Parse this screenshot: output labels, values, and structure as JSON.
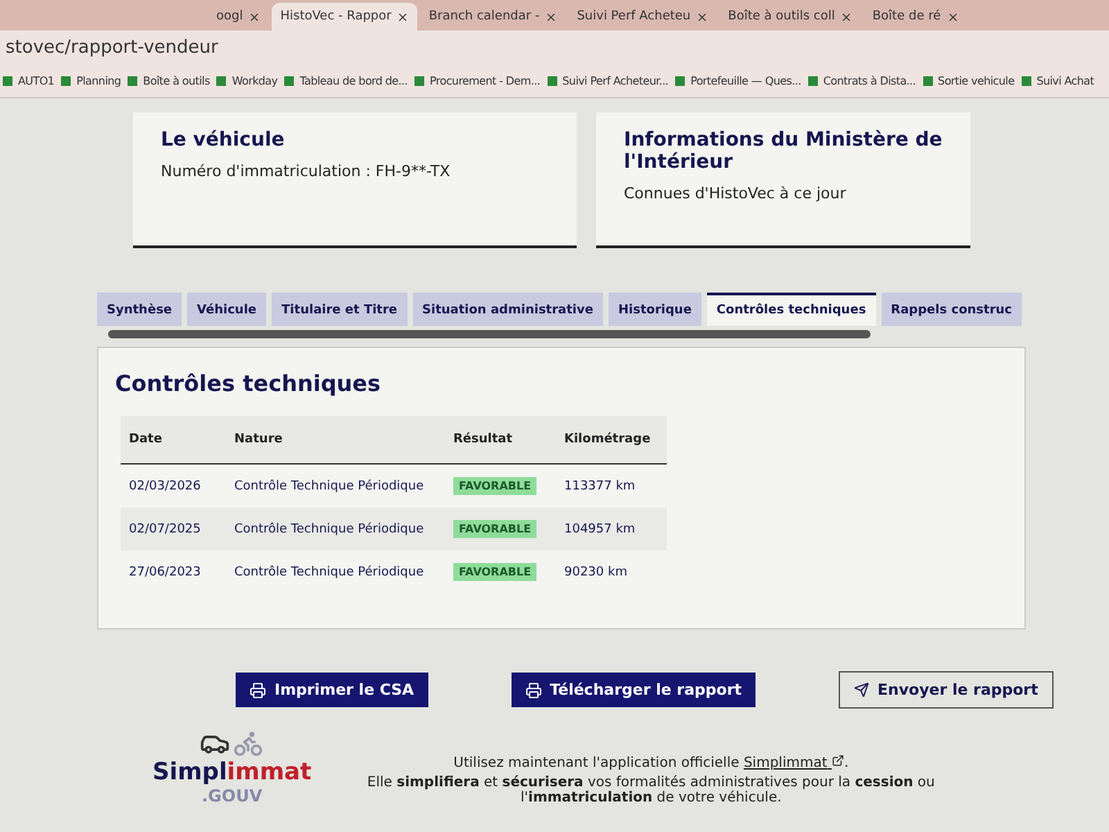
{
  "browser": {
    "tabs": [
      {
        "title": "oogl",
        "selected": false
      },
      {
        "title": "HistoVec - Rappor",
        "selected": true
      },
      {
        "title": "Branch calendar -",
        "selected": false
      },
      {
        "title": "Suivi Perf Acheteu",
        "selected": false
      },
      {
        "title": "Boîte à outils coll",
        "selected": false
      },
      {
        "title": "Boîte de ré",
        "selected": false
      }
    ],
    "address": "stovec/rapport-vendeur",
    "bookmarks": [
      "AUTO1",
      "Planning",
      "Boîte à outils",
      "Workday",
      "Tableau de bord de...",
      "Procurement - Dem...",
      "Suivi Perf Acheteur...",
      "Portefeuille — Ques...",
      "Contrats à Dista...",
      "Sortie vehicule",
      "Suivi Achat"
    ]
  },
  "cards": [
    {
      "title": "Le véhicule",
      "text": "Numéro d'immatriculation : FH-9**-TX"
    },
    {
      "title": "Informations du Ministère de l'Intérieur",
      "text": "Connues d'HistoVec à ce jour"
    }
  ],
  "tabs": [
    {
      "label": "Synthèse",
      "selected": false
    },
    {
      "label": "Véhicule",
      "selected": false
    },
    {
      "label": "Titulaire et Titre",
      "selected": false
    },
    {
      "label": "Situation administrative",
      "selected": false
    },
    {
      "label": "Historique",
      "selected": false
    },
    {
      "label": "Contrôles techniques",
      "selected": true
    },
    {
      "label": "Rappels construc",
      "selected": false
    }
  ],
  "section_title": "Contrôles techniques",
  "table": {
    "columns": [
      "Date",
      "Nature",
      "Résultat",
      "Kilométrage"
    ],
    "rows": [
      [
        "02/03/2026",
        "Contrôle Technique Périodique",
        "FAVORABLE",
        "113377 km"
      ],
      [
        "02/07/2025",
        "Contrôle Technique Périodique",
        "FAVORABLE",
        "104957 km"
      ],
      [
        "27/06/2023",
        "Contrôle Technique Périodique",
        "FAVORABLE",
        "90230 km"
      ]
    ]
  },
  "buttons": [
    {
      "label": "Imprimer le CSA",
      "kind": "primary"
    },
    {
      "label": "Télécharger le rapport",
      "kind": "primary"
    },
    {
      "label": "Envoyer le rapport",
      "kind": "secondary"
    }
  ],
  "footer": {
    "logo": {
      "part_1": "Simpl",
      "part_2": "immat",
      "suffix": ".GOUV"
    },
    "intro": "Utilisez maintenant l'application officielle",
    "link": "Simplimmat",
    "tail": ".",
    "text": "Elle **simplifiera** et **sécurisera** vos formalités administratives pour la **cession** ou l'**immatriculation** de votre véhicule."
  }
}
